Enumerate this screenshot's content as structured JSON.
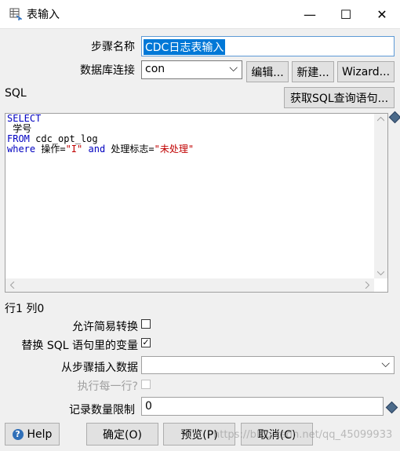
{
  "window": {
    "title": "表输入",
    "minimize_glyph": "—",
    "maximize_glyph": "☐",
    "close_glyph": "✕"
  },
  "step_name": {
    "label": "步骤名称",
    "value": "CDC日志表输入"
  },
  "db_connection": {
    "label": "数据库连接",
    "value": "con",
    "edit_label": "编辑...",
    "new_label": "新建...",
    "wizard_label": "Wizard..."
  },
  "sql": {
    "label": "SQL",
    "get_sql_label": "获取SQL查询语句...",
    "line1": "SELECT",
    "line2": " 学号",
    "line3_kw": "FROM",
    "line3_rest": " cdc_opt_log",
    "line4_kw1": "where",
    "line4_t1": " 操作=",
    "line4_s1": "\"I\"",
    "line4_t2": " ",
    "line4_kw2": "and",
    "line4_t3": " 处理标志=",
    "line4_s2": "\"未处理\""
  },
  "status": {
    "position": "行1 列0"
  },
  "options": {
    "lazy_conversion_label": "允许简易转换",
    "lazy_conversion_checked": false,
    "replace_vars_label": "替换 SQL 语句里的变量",
    "replace_vars_checked": true,
    "insert_from_step_label": "从步骤插入数据",
    "insert_from_step_value": "",
    "execute_each_row_label": "执行每一行?",
    "execute_each_row_checked": false,
    "limit_label": "记录数量限制",
    "limit_value": "0"
  },
  "buttons": {
    "help_label": "Help",
    "ok_label": "确定(O)",
    "preview_label": "预览(P)",
    "cancel_label": "取消(C)"
  },
  "watermark": "https://blog.csdn.net/qq_45099933",
  "icons": {
    "check_glyph": "✓",
    "dropdown_glyph": "⌵",
    "help_glyph": "?"
  }
}
